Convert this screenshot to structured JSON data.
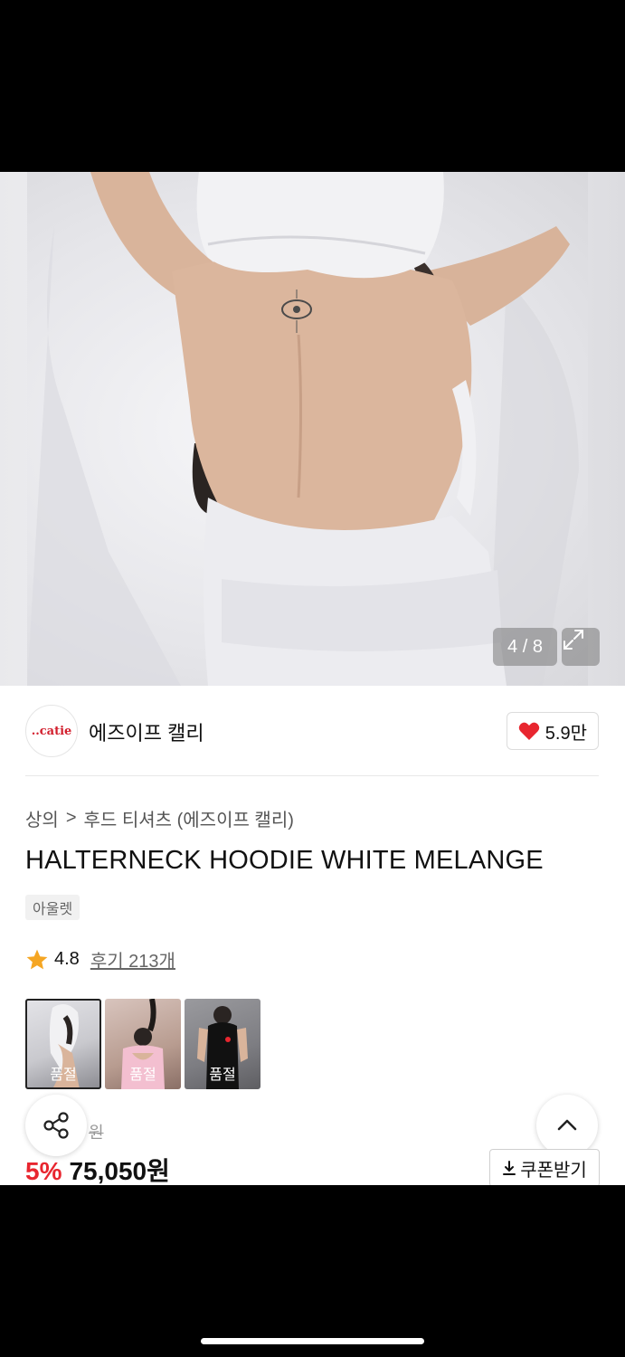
{
  "gallery": {
    "counter": "4 / 8"
  },
  "brand": {
    "logo_text": "..catie",
    "name": "에즈이프 캘리",
    "likes": "5.9만"
  },
  "breadcrumb": {
    "category": "상의",
    "separator": ">",
    "subcategory": "후드 티셔츠 (에즈이프 캘리)"
  },
  "product": {
    "title": "HALTERNECK HOODIE WHITE MELANGE",
    "tag": "아울렛",
    "rating": "4.8",
    "reviews": "후기 213개",
    "original_price_suffix": "원",
    "discount": "5%",
    "price": "75,050원"
  },
  "thumbnails": [
    {
      "label": "품절",
      "selected": true
    },
    {
      "label": "품절",
      "selected": false
    },
    {
      "label": "품절",
      "selected": false
    }
  ],
  "actions": {
    "coupon": "쿠폰받기"
  },
  "colors": {
    "accent_red": "#e8262f",
    "heart": "#e8262f",
    "star": "#f5a623"
  }
}
